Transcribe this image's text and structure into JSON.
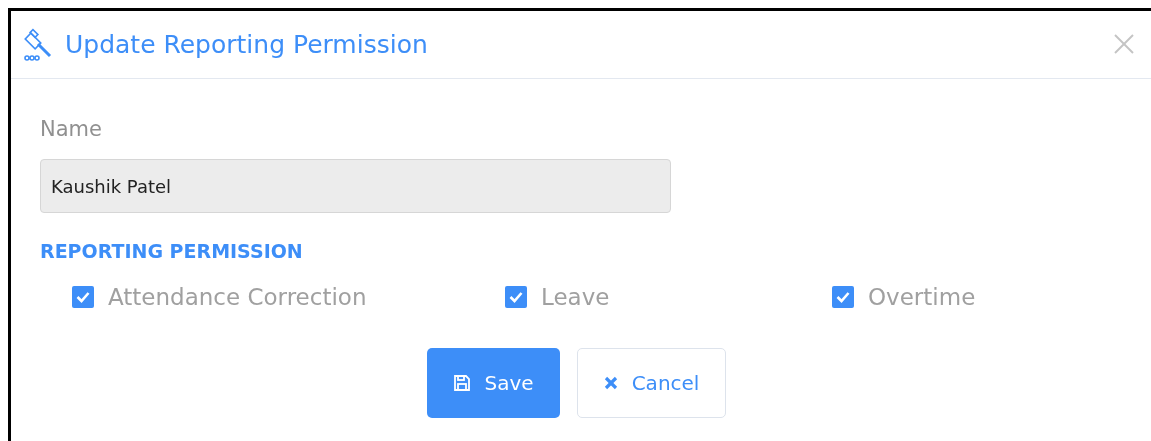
{
  "dialog": {
    "title": "Update Reporting Permission"
  },
  "name_field": {
    "label": "Name",
    "value": "Kaushik Patel"
  },
  "section": {
    "heading": "REPORTING PERMISSION"
  },
  "permissions": [
    {
      "label": "Attendance Correction",
      "checked": true
    },
    {
      "label": "Leave",
      "checked": true
    },
    {
      "label": "Overtime",
      "checked": true
    }
  ],
  "buttons": [
    {
      "kind": "save",
      "label": "Save"
    },
    {
      "kind": "cancel",
      "label": "Cancel"
    }
  ]
}
